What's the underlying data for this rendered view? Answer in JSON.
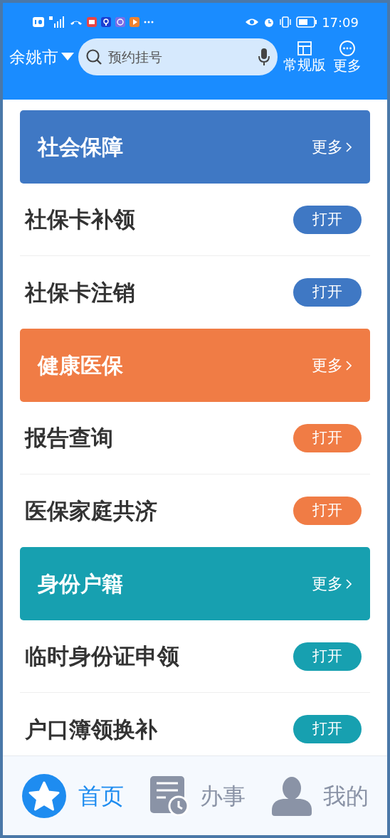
{
  "status_bar": {
    "time": "17:09"
  },
  "header": {
    "city": "余姚市",
    "search": {
      "placeholder": "预约挂号"
    },
    "actions": [
      {
        "kind": "layout",
        "label": "常规版"
      },
      {
        "kind": "more",
        "label": "更多"
      }
    ]
  },
  "sections": [
    {
      "title": "社会保障",
      "more": "更多",
      "color": "#3f78c4",
      "items": [
        {
          "label": "社保卡补领",
          "button": "打开"
        },
        {
          "label": "社保卡注销",
          "button": "打开"
        }
      ]
    },
    {
      "title": "健康医保",
      "more": "更多",
      "color": "#f07c45",
      "items": [
        {
          "label": "报告查询",
          "button": "打开"
        },
        {
          "label": "医保家庭共济",
          "button": "打开"
        }
      ]
    },
    {
      "title": "身份户籍",
      "more": "更多",
      "color": "#17a0b0",
      "items": [
        {
          "label": "临时身份证申领",
          "button": "打开"
        },
        {
          "label": "户口簿领换补",
          "button": "打开"
        }
      ]
    }
  ],
  "tabbar": [
    {
      "kind": "home",
      "label": "首页",
      "selected": true
    },
    {
      "kind": "tasks",
      "label": "办事",
      "selected": false
    },
    {
      "kind": "me",
      "label": "我的",
      "selected": false
    }
  ]
}
